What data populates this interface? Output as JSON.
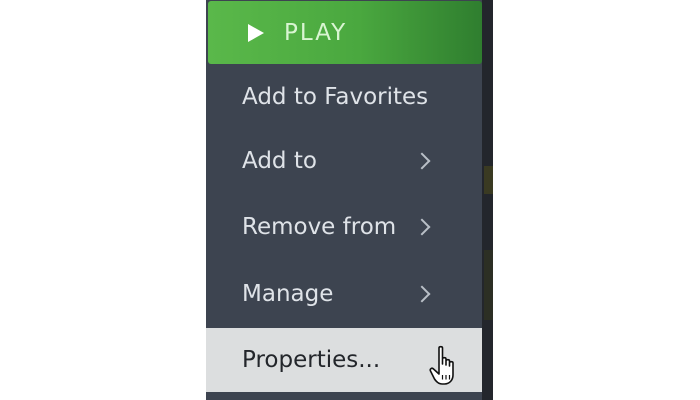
{
  "menu": {
    "play_label": "PLAY",
    "items": [
      {
        "label": "Add to Favorites",
        "has_submenu": false
      },
      {
        "label": "Add to",
        "has_submenu": true
      },
      {
        "label": "Remove from",
        "has_submenu": true
      },
      {
        "label": "Manage",
        "has_submenu": true
      },
      {
        "label": "Properties...",
        "has_submenu": false,
        "hovered": true
      }
    ]
  },
  "icons": {
    "play": "play-icon",
    "submenu": "chevron-right-icon",
    "cursor": "hand-pointer-icon"
  },
  "colors": {
    "menu_bg": "#3d4450",
    "play_green": "#5ab84a",
    "hover_bg": "#dcdedf",
    "text": "#dfe3e8"
  }
}
